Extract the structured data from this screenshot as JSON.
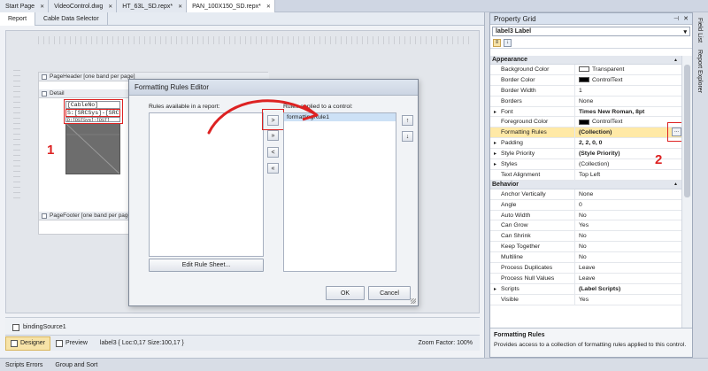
{
  "doc_tabs": [
    {
      "label": "Start Page",
      "active": false
    },
    {
      "label": "VideoControl.dwg",
      "active": false
    },
    {
      "label": "HT_63L_SD.repx*",
      "active": false
    },
    {
      "label": "PAN_100X150_SD.repx*",
      "active": true
    }
  ],
  "sub_tabs": [
    "Report",
    "Cable Data Selector"
  ],
  "designer": {
    "page_header": "PageHeader [one band per page]",
    "detail": "Detail",
    "page_footer": "PageFooter [one band per page]",
    "controls": [
      "[CableNo]",
      "S:[SRCSys]-[SRC]",
      "D:[DSTSys]-[DST]"
    ],
    "annotation_1": "1",
    "annotation_2": "2",
    "binding_source": "bindingSource1"
  },
  "status_bar": {
    "designer": "Designer",
    "preview": "Preview",
    "selection": "label3 { Loc:0,17 Size:100,17 }",
    "zoom": "Zoom Factor: 100%"
  },
  "bottom_tabs": [
    "Scripts Errors",
    "Group and Sort"
  ],
  "property_grid": {
    "title": "Property Grid",
    "selected_object": "label3  Label",
    "categories": [
      {
        "name": "Appearance",
        "rows": [
          {
            "key": "Background Color",
            "value": "Transparent",
            "swatch": "#ffffff"
          },
          {
            "key": "Border Color",
            "value": "ControlText",
            "swatch": "#000000"
          },
          {
            "key": "Border Width",
            "value": "1"
          },
          {
            "key": "Borders",
            "value": "None"
          },
          {
            "key": "Font",
            "value": "Times New Roman, 8pt",
            "expand": true,
            "bold": true
          },
          {
            "key": "Foreground Color",
            "value": "ControlText",
            "swatch": "#000000"
          },
          {
            "key": "Formatting Rules",
            "value": "(Collection)",
            "bold": true,
            "selected": true
          },
          {
            "key": "Padding",
            "value": "2, 2, 0, 0",
            "expand": true,
            "bold": true
          },
          {
            "key": "Style Priority",
            "value": "(Style Priority)",
            "expand": true,
            "bold": true
          },
          {
            "key": "Styles",
            "value": "(Collection)",
            "expand": true
          },
          {
            "key": "Text Alignment",
            "value": "Top Left"
          }
        ]
      },
      {
        "name": "Behavior",
        "rows": [
          {
            "key": "Anchor Vertically",
            "value": "None"
          },
          {
            "key": "Angle",
            "value": "0"
          },
          {
            "key": "Auto Width",
            "value": "No"
          },
          {
            "key": "Can Grow",
            "value": "Yes"
          },
          {
            "key": "Can Shrink",
            "value": "No"
          },
          {
            "key": "Keep Together",
            "value": "No"
          },
          {
            "key": "Multiline",
            "value": "No"
          },
          {
            "key": "Process Duplicates",
            "value": "Leave"
          },
          {
            "key": "Process Null Values",
            "value": "Leave"
          },
          {
            "key": "Scripts",
            "value": "(Label Scripts)",
            "expand": true,
            "bold": true
          },
          {
            "key": "Visible",
            "value": "Yes"
          }
        ]
      }
    ],
    "ellipsis": "...",
    "description_title": "Formatting Rules",
    "description_text": "Provides access to a collection of formatting rules applied to this control."
  },
  "side_tabs": [
    "Field List",
    "Report Explorer"
  ],
  "dialog": {
    "title": "Formatting Rules Editor",
    "available_label": "Rules available in a report:",
    "applied_label": "Rules applied to a control:",
    "applied_items": [
      "formattingRule1"
    ],
    "move_buttons": [
      ">",
      "»",
      "<",
      "«"
    ],
    "edit_button": "Edit Rule Sheet...",
    "ok_button": "OK",
    "cancel_button": "Cancel"
  },
  "colors": {
    "annotation": "#dd2222",
    "selection": "#ffe9a6"
  }
}
